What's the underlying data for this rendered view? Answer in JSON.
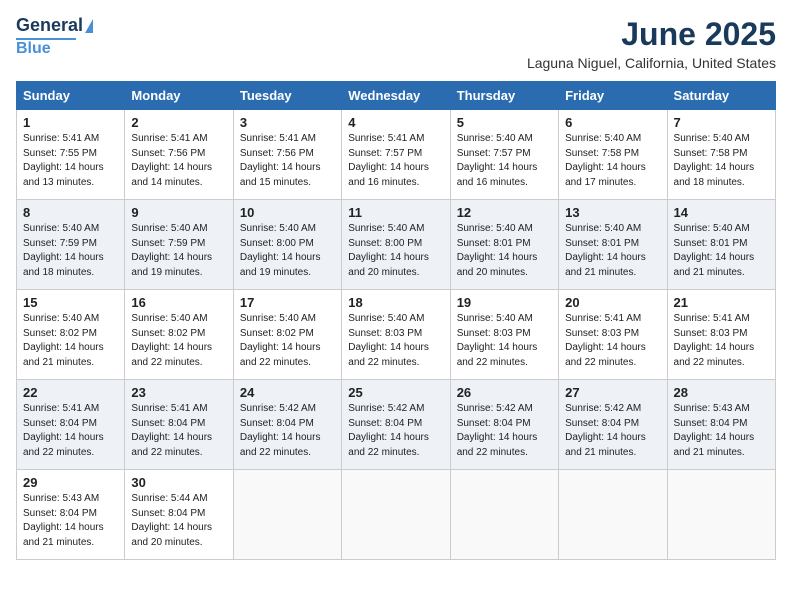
{
  "logo": {
    "line1": "General",
    "line2": "Blue"
  },
  "title": "June 2025",
  "location": "Laguna Niguel, California, United States",
  "weekdays": [
    "Sunday",
    "Monday",
    "Tuesday",
    "Wednesday",
    "Thursday",
    "Friday",
    "Saturday"
  ],
  "weeks": [
    [
      {
        "day": "1",
        "info": "Sunrise: 5:41 AM\nSunset: 7:55 PM\nDaylight: 14 hours\nand 13 minutes."
      },
      {
        "day": "2",
        "info": "Sunrise: 5:41 AM\nSunset: 7:56 PM\nDaylight: 14 hours\nand 14 minutes."
      },
      {
        "day": "3",
        "info": "Sunrise: 5:41 AM\nSunset: 7:56 PM\nDaylight: 14 hours\nand 15 minutes."
      },
      {
        "day": "4",
        "info": "Sunrise: 5:41 AM\nSunset: 7:57 PM\nDaylight: 14 hours\nand 16 minutes."
      },
      {
        "day": "5",
        "info": "Sunrise: 5:40 AM\nSunset: 7:57 PM\nDaylight: 14 hours\nand 16 minutes."
      },
      {
        "day": "6",
        "info": "Sunrise: 5:40 AM\nSunset: 7:58 PM\nDaylight: 14 hours\nand 17 minutes."
      },
      {
        "day": "7",
        "info": "Sunrise: 5:40 AM\nSunset: 7:58 PM\nDaylight: 14 hours\nand 18 minutes."
      }
    ],
    [
      {
        "day": "8",
        "info": "Sunrise: 5:40 AM\nSunset: 7:59 PM\nDaylight: 14 hours\nand 18 minutes."
      },
      {
        "day": "9",
        "info": "Sunrise: 5:40 AM\nSunset: 7:59 PM\nDaylight: 14 hours\nand 19 minutes."
      },
      {
        "day": "10",
        "info": "Sunrise: 5:40 AM\nSunset: 8:00 PM\nDaylight: 14 hours\nand 19 minutes."
      },
      {
        "day": "11",
        "info": "Sunrise: 5:40 AM\nSunset: 8:00 PM\nDaylight: 14 hours\nand 20 minutes."
      },
      {
        "day": "12",
        "info": "Sunrise: 5:40 AM\nSunset: 8:01 PM\nDaylight: 14 hours\nand 20 minutes."
      },
      {
        "day": "13",
        "info": "Sunrise: 5:40 AM\nSunset: 8:01 PM\nDaylight: 14 hours\nand 21 minutes."
      },
      {
        "day": "14",
        "info": "Sunrise: 5:40 AM\nSunset: 8:01 PM\nDaylight: 14 hours\nand 21 minutes."
      }
    ],
    [
      {
        "day": "15",
        "info": "Sunrise: 5:40 AM\nSunset: 8:02 PM\nDaylight: 14 hours\nand 21 minutes."
      },
      {
        "day": "16",
        "info": "Sunrise: 5:40 AM\nSunset: 8:02 PM\nDaylight: 14 hours\nand 22 minutes."
      },
      {
        "day": "17",
        "info": "Sunrise: 5:40 AM\nSunset: 8:02 PM\nDaylight: 14 hours\nand 22 minutes."
      },
      {
        "day": "18",
        "info": "Sunrise: 5:40 AM\nSunset: 8:03 PM\nDaylight: 14 hours\nand 22 minutes."
      },
      {
        "day": "19",
        "info": "Sunrise: 5:40 AM\nSunset: 8:03 PM\nDaylight: 14 hours\nand 22 minutes."
      },
      {
        "day": "20",
        "info": "Sunrise: 5:41 AM\nSunset: 8:03 PM\nDaylight: 14 hours\nand 22 minutes."
      },
      {
        "day": "21",
        "info": "Sunrise: 5:41 AM\nSunset: 8:03 PM\nDaylight: 14 hours\nand 22 minutes."
      }
    ],
    [
      {
        "day": "22",
        "info": "Sunrise: 5:41 AM\nSunset: 8:04 PM\nDaylight: 14 hours\nand 22 minutes."
      },
      {
        "day": "23",
        "info": "Sunrise: 5:41 AM\nSunset: 8:04 PM\nDaylight: 14 hours\nand 22 minutes."
      },
      {
        "day": "24",
        "info": "Sunrise: 5:42 AM\nSunset: 8:04 PM\nDaylight: 14 hours\nand 22 minutes."
      },
      {
        "day": "25",
        "info": "Sunrise: 5:42 AM\nSunset: 8:04 PM\nDaylight: 14 hours\nand 22 minutes."
      },
      {
        "day": "26",
        "info": "Sunrise: 5:42 AM\nSunset: 8:04 PM\nDaylight: 14 hours\nand 22 minutes."
      },
      {
        "day": "27",
        "info": "Sunrise: 5:42 AM\nSunset: 8:04 PM\nDaylight: 14 hours\nand 21 minutes."
      },
      {
        "day": "28",
        "info": "Sunrise: 5:43 AM\nSunset: 8:04 PM\nDaylight: 14 hours\nand 21 minutes."
      }
    ],
    [
      {
        "day": "29",
        "info": "Sunrise: 5:43 AM\nSunset: 8:04 PM\nDaylight: 14 hours\nand 21 minutes."
      },
      {
        "day": "30",
        "info": "Sunrise: 5:44 AM\nSunset: 8:04 PM\nDaylight: 14 hours\nand 20 minutes."
      },
      {
        "day": "",
        "info": ""
      },
      {
        "day": "",
        "info": ""
      },
      {
        "day": "",
        "info": ""
      },
      {
        "day": "",
        "info": ""
      },
      {
        "day": "",
        "info": ""
      }
    ]
  ]
}
